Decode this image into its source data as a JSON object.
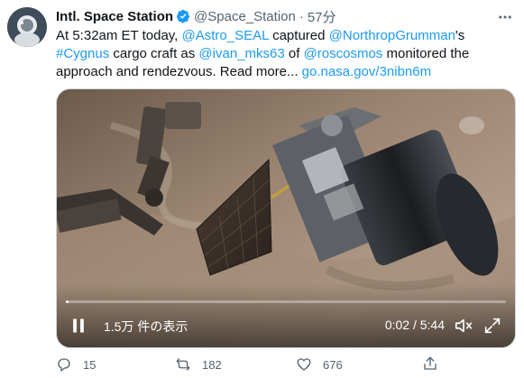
{
  "tweet": {
    "author_name": "Intl. Space Station",
    "handle": "@Space_Station",
    "separator": "·",
    "time": "57分",
    "text": {
      "part1": "At 5:32am ET today, ",
      "mention1": "@Astro_SEAL",
      "part2": " captured ",
      "mention2": "@NorthropGrumman",
      "part3": "'s ",
      "hashtag": "#Cygnus",
      "part4": " cargo craft as ",
      "mention3": "@ivan_mks63",
      "part5": " of ",
      "mention4": "@roscosmos",
      "part6": " monitored the approach and rendezvous. Read more... ",
      "url": "go.nasa.gov/3nibn6m"
    }
  },
  "video": {
    "views": "1.5万 件の表示",
    "time": "0:02 / 5:44",
    "progress": 0.006
  },
  "actions": {
    "replies": "15",
    "retweets": "182",
    "likes": "676"
  },
  "icons": {
    "verified": "verified-badge-icon",
    "more": "more-icon",
    "pause": "pause-icon",
    "mute": "mute-icon",
    "fullscreen": "fullscreen-icon",
    "reply": "reply-icon",
    "retweet": "retweet-icon",
    "like": "heart-icon",
    "share": "share-icon"
  },
  "colors": {
    "link": "#1d9bf0",
    "muted": "#536471",
    "verified": "#1d9bf0"
  }
}
